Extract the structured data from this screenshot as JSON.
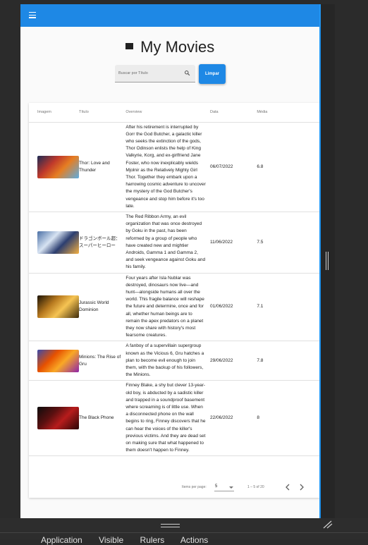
{
  "toolbar": {
    "menu_icon": "menu-icon"
  },
  "heading": {
    "icon": "movie-clapperboard-icon",
    "title": "My Movies"
  },
  "search": {
    "placeholder": "Buscar por Título",
    "value": "",
    "icon": "search-icon"
  },
  "clear_button": {
    "label": "Limpar"
  },
  "table": {
    "columns": [
      "Imagem",
      "Título",
      "Overview",
      "Data",
      "Média"
    ],
    "rows": [
      {
        "title": "Thor: Love and Thunder",
        "overview": "After his retirement is interrupted by Gorr the God Butcher, a galactic killer who seeks the extinction of the gods, Thor Odinson enlists the help of King Valkyrie, Korg, and ex-girlfriend Jane Foster, who now inexplicably wields Mjolnir as the Relatively Mighty Girl Thor. Together they embark upon a harrowing cosmic adventure to uncover the mystery of the God Butcher's vengeance and stop him before it's too late.",
        "date": "06/07/2022",
        "avg": "6.8",
        "poster_colors": [
          "#1b2a55",
          "#c0392b",
          "#e67e22",
          "#5dade2"
        ]
      },
      {
        "title": "ドラゴンボール超：スーパーヒーロー",
        "overview": "The Red Ribbon Army, an evil organization that was once destroyed by Goku in the past, has been reformed by a group of people who have created new and mightier Androids, Gamma 1 and Gamma 2, and seek vengeance against Goku and his family.",
        "date": "11/06/2022",
        "avg": "7.5",
        "poster_colors": [
          "#4a6fa5",
          "#d7e3f2",
          "#2c3e70",
          "#f5b041"
        ]
      },
      {
        "title": "Jurassic World Dominion",
        "overview": "Four years after Isla Nublar was destroyed, dinosaurs now live—and hunt—alongside humans all over the world. This fragile balance will reshape the future and determine, once and for all, whether human beings are to remain the apex predators on a planet they now share with history's most fearsome creatures.",
        "date": "01/06/2022",
        "avg": "7.1",
        "poster_colors": [
          "#1a1205",
          "#b7791f",
          "#f6c453",
          "#3d2a0a"
        ]
      },
      {
        "title": "Minions: The Rise of Gru",
        "overview": "A fanboy of a supervillain supergroup known as the Vicious 6, Gru hatches a plan to become evil enough to join them, with the backup of his followers, the Minions.",
        "date": "29/06/2022",
        "avg": "7.8",
        "poster_colors": [
          "#3949ab",
          "#e65100",
          "#f9a825",
          "#8e24aa"
        ]
      },
      {
        "title": "The Black Phone",
        "overview": "Finney Blake, a shy but clever 13-year-old boy, is abducted by a sadistic killer and trapped in a soundproof basement where screaming is of little use. When a disconnected phone on the wall begins to ring, Finney discovers that he can hear the voices of the killer's previous victims. And they are dead set on making sure that what happened to them doesn't happen to Finney.",
        "date": "22/06/2022",
        "avg": "8",
        "poster_colors": [
          "#0d0d0d",
          "#5a1010",
          "#b71c1c",
          "#2a0505"
        ]
      }
    ]
  },
  "paginator": {
    "items_label": "Items per page:",
    "page_size": "5",
    "range_label": "1 – 5 of 20"
  },
  "bottom_tabs": [
    "Application",
    "Visible",
    "Rulers",
    "Actions"
  ]
}
